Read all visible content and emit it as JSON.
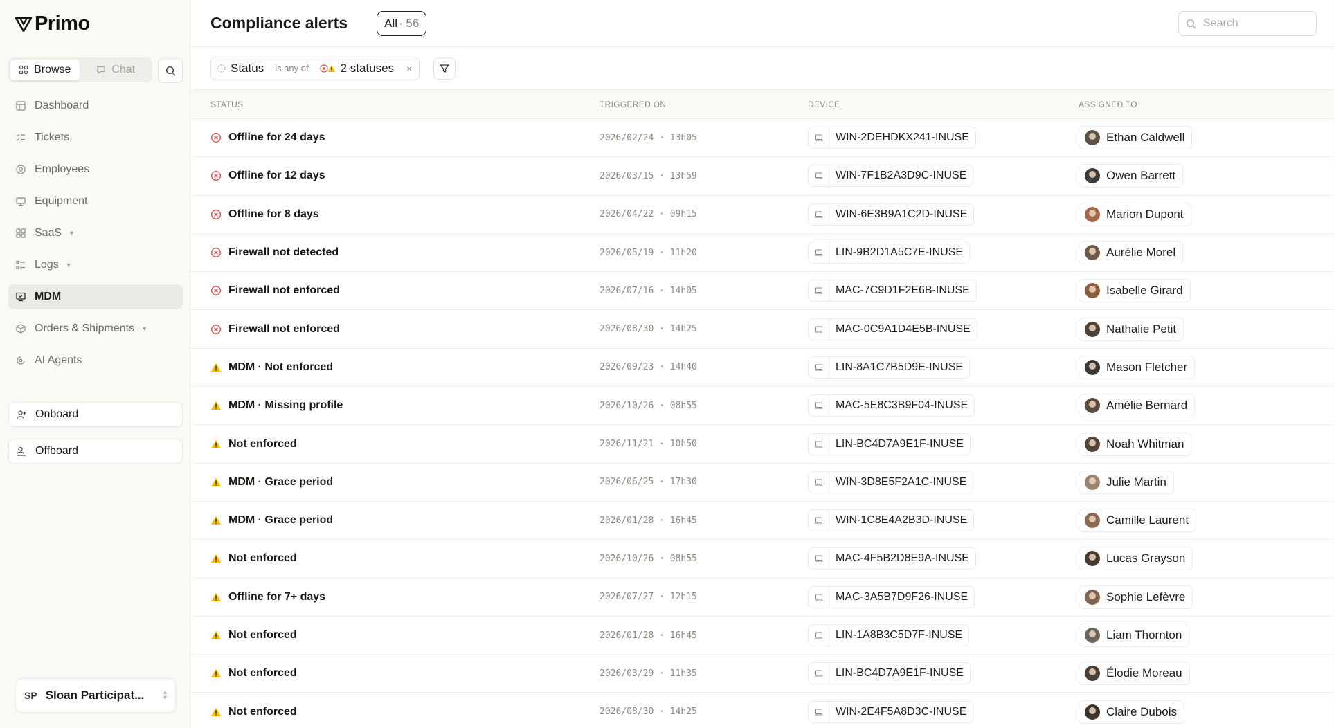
{
  "app": {
    "name": "Primo"
  },
  "sidebar": {
    "mode_browse": "Browse",
    "mode_chat": "Chat",
    "nav": [
      {
        "label": "Dashboard",
        "icon": "dashboard-icon"
      },
      {
        "label": "Tickets",
        "icon": "tickets-icon"
      },
      {
        "label": "Employees",
        "icon": "employees-icon"
      },
      {
        "label": "Equipment",
        "icon": "equipment-icon"
      },
      {
        "label": "SaaS",
        "icon": "saas-icon",
        "expandable": true
      },
      {
        "label": "Logs",
        "icon": "logs-icon",
        "expandable": true
      },
      {
        "label": "MDM",
        "icon": "mdm-icon",
        "active": true
      },
      {
        "label": "Orders & Shipments",
        "icon": "orders-icon",
        "expandable": true
      },
      {
        "label": "AI Agents",
        "icon": "ai-agents-icon"
      }
    ],
    "onboard": "Onboard",
    "offboard": "Offboard",
    "user": {
      "initials": "SP",
      "name": "Sloan Participat..."
    }
  },
  "header": {
    "title": "Compliance alerts",
    "all_label": "All",
    "all_count": "· 56",
    "search_placeholder": "Search"
  },
  "filter": {
    "field": "Status",
    "operator": "is any of",
    "value": "2 statuses",
    "clear": "×"
  },
  "table": {
    "columns": [
      "STATUS",
      "TRIGGERED ON",
      "DEVICE",
      "ASSIGNED TO"
    ],
    "rows": [
      {
        "type": "error",
        "status": "Offline for 24 days",
        "triggered": "2026/02/24 · 13h05",
        "device": "WIN-2DEHDKX241-INUSE",
        "assignee": "Ethan Caldwell",
        "avatar": "#5b5148"
      },
      {
        "type": "error",
        "status": "Offline for 12 days",
        "triggered": "2026/03/15 · 13h59",
        "device": "WIN-7F1B2A3D9C-INUSE",
        "assignee": "Owen Barrett",
        "avatar": "#3c3a38"
      },
      {
        "type": "error",
        "status": "Offline for 8 days",
        "triggered": "2026/04/22 · 09h15",
        "device": "WIN-6E3B9A1C2D-INUSE",
        "assignee": "Marion Dupont",
        "avatar": "#a3674a"
      },
      {
        "type": "error",
        "status": "Firewall not detected",
        "triggered": "2026/05/19 · 11h20",
        "device": "LIN-9B2D1A5C7E-INUSE",
        "assignee": "Aurélie Morel",
        "avatar": "#6e5a49"
      },
      {
        "type": "error",
        "status": "Firewall not enforced",
        "triggered": "2026/07/16 · 14h05",
        "device": "MAC-7C9D1F2E6B-INUSE",
        "assignee": "Isabelle Girard",
        "avatar": "#8c5c3f"
      },
      {
        "type": "error",
        "status": "Firewall not enforced",
        "triggered": "2026/08/30 · 14h25",
        "device": "MAC-0C9A1D4E5B-INUSE",
        "assignee": "Nathalie Petit",
        "avatar": "#4f4238"
      },
      {
        "type": "warning",
        "status": "MDM · Not enforced",
        "triggered": "2026/09/23 · 14h40",
        "device": "LIN-8A1C7B5D9E-INUSE",
        "assignee": "Mason Fletcher",
        "avatar": "#3a3836"
      },
      {
        "type": "warning",
        "status": "MDM · Missing profile",
        "triggered": "2026/10/26 · 08h55",
        "device": "MAC-5E8C3B9F04-INUSE",
        "assignee": "Amélie Bernard",
        "avatar": "#5c4a3e"
      },
      {
        "type": "warning",
        "status": "Not enforced",
        "triggered": "2026/11/21 · 10h50",
        "device": "LIN-BC4D7A9E1F-INUSE",
        "assignee": "Noah Whitman",
        "avatar": "#514338"
      },
      {
        "type": "warning",
        "status": "MDM · Grace period",
        "triggered": "2026/06/25 · 17h30",
        "device": "WIN-3D8E5F2A1C-INUSE",
        "assignee": "Julie Martin",
        "avatar": "#9a8470"
      },
      {
        "type": "warning",
        "status": "MDM · Grace period",
        "triggered": "2026/01/28 · 16h45",
        "device": "WIN-1C8E4A2B3D-INUSE",
        "assignee": "Camille Laurent",
        "avatar": "#8a6a52"
      },
      {
        "type": "warning",
        "status": "Not enforced",
        "triggered": "2026/10/26 · 08h55",
        "device": "MAC-4F5B2D8E9A-INUSE",
        "assignee": "Lucas Grayson",
        "avatar": "#453a32"
      },
      {
        "type": "warning",
        "status": "Offline for 7+ days",
        "triggered": "2026/07/27 · 12h15",
        "device": "MAC-3A5B7D9F26-INUSE",
        "assignee": "Sophie Lefèvre",
        "avatar": "#7d6552"
      },
      {
        "type": "warning",
        "status": "Not enforced",
        "triggered": "2026/01/28 · 16h45",
        "device": "LIN-1A8B3C5D7F-INUSE",
        "assignee": "Liam Thornton",
        "avatar": "#6b6560"
      },
      {
        "type": "warning",
        "status": "Not enforced",
        "triggered": "2026/03/29 · 11h35",
        "device": "LIN-BC4D7A9E1F-INUSE",
        "assignee": "Élodie Moreau",
        "avatar": "#4a3f37"
      },
      {
        "type": "warning",
        "status": "Not enforced",
        "triggered": "2026/08/30 · 14h25",
        "device": "WIN-2E4F5A8D3C-INUSE",
        "assignee": "Claire Dubois",
        "avatar": "#3b332e"
      }
    ]
  },
  "colors": {
    "error": "#d9534f",
    "warning": "#f2c200",
    "accent": "#1f1d1a"
  }
}
